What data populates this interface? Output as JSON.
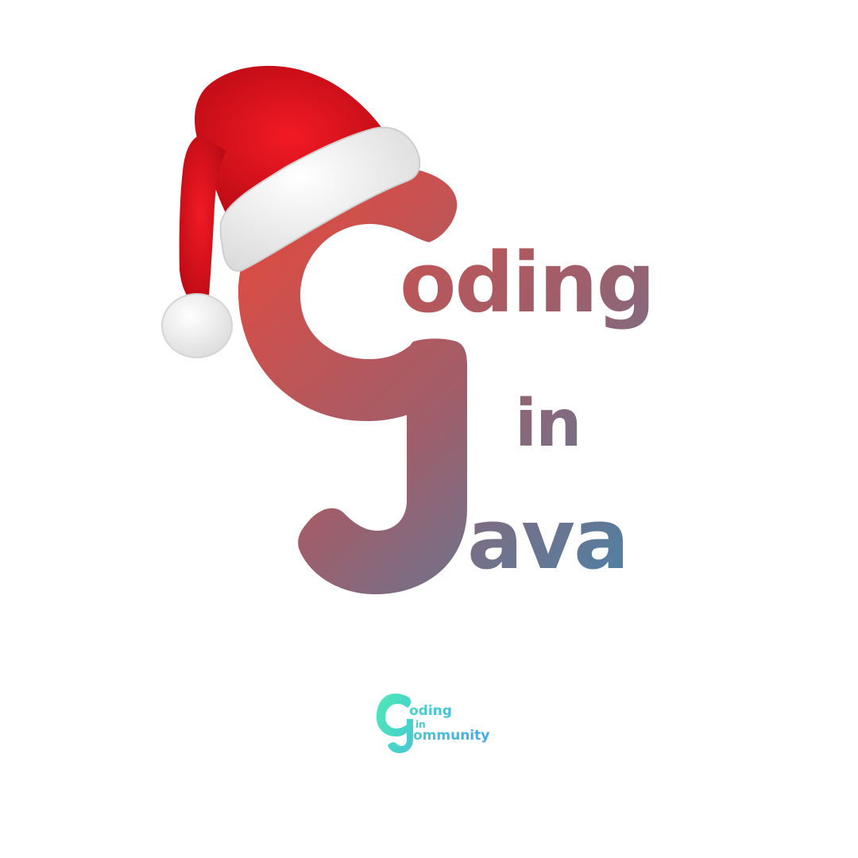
{
  "main_logo": {
    "line1": "oding",
    "line2": "in",
    "line3": "ava",
    "colors": {
      "gradient_start": "#e8483b",
      "gradient_end": "#4f80a3",
      "hat_red": "#e3101c",
      "hat_white": "#f4f4f4"
    }
  },
  "footer_logo": {
    "line1": "oding",
    "line2": "in",
    "line3": "ommunity",
    "colors": {
      "gradient_start": "#4ee8b8",
      "gradient_end": "#3fa6f0"
    }
  }
}
